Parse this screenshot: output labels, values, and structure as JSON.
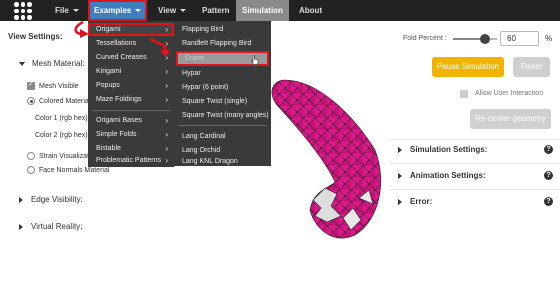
{
  "nav": {
    "file": "File",
    "examples": "Examples",
    "view": "View",
    "pattern": "Pattern",
    "simulation": "Simulation",
    "about": "About"
  },
  "left": {
    "title": "View Settings:",
    "mesh_material": "Mesh Material:",
    "mesh_visible": "Mesh Visible",
    "colored_material": "Colored Material",
    "color1": "Color 1 (rgb hex):",
    "color2": "Color 2 (rgb hex):",
    "strain_vis": "Strain Visualization",
    "face_normals": "Face Normals Material",
    "edge_visibility": "Edge Visibility:",
    "virtual_reality": "Virtual Reality:"
  },
  "examples_menu": {
    "items": [
      {
        "label": "Origami",
        "submenu": true
      },
      {
        "label": "Tessellations",
        "submenu": true
      },
      {
        "label": "Curved Creases",
        "submenu": true
      },
      {
        "label": "Kirigami",
        "submenu": true
      },
      {
        "label": "Popups",
        "submenu": true
      },
      {
        "label": "Maze Foldings",
        "submenu": true
      },
      {
        "label": "Origami Bases",
        "submenu": true
      },
      {
        "label": "Simple Folds",
        "submenu": true
      },
      {
        "label": "Bistable",
        "submenu": true
      },
      {
        "label": "Problematic Patterns",
        "submenu": true
      }
    ]
  },
  "origami_menu": {
    "items": [
      {
        "label": "Flapping Bird"
      },
      {
        "label": "Randlett Flapping Bird"
      },
      {
        "label": "Crane"
      },
      {
        "label": "Hypar"
      },
      {
        "label": "Hypar (6 point)"
      },
      {
        "label": "Square Twist (single)"
      },
      {
        "label": "Square Twist (many angles)"
      },
      {
        "label": "Lang Cardinal"
      },
      {
        "label": "Lang Orchid"
      },
      {
        "label": "Lang KNL Dragon"
      }
    ]
  },
  "right": {
    "fold_percent_label": "Fold Percent :",
    "fold_percent_value": "60",
    "fold_percent_fraction": 0.6,
    "percent_sign": "%",
    "pause_button": "Pause Simulation",
    "reset_button": "Reset",
    "allow_interaction": "Allow User Interaction",
    "recenter_button": "Re-center geometry",
    "sections": [
      {
        "label": "Simulation Settings:"
      },
      {
        "label": "Animation Settings:"
      },
      {
        "label": "Error:"
      }
    ],
    "help_glyph": "?"
  },
  "colors": {
    "topbar": "#222222",
    "examples_active": "#3f7fbf",
    "simulation_tab": "#8a8a8a",
    "menu_bg": "#3a3a3a",
    "highlight_red": "#e0141b",
    "pause_yellow": "#f0b400",
    "model_magenta": "#e0168c"
  }
}
